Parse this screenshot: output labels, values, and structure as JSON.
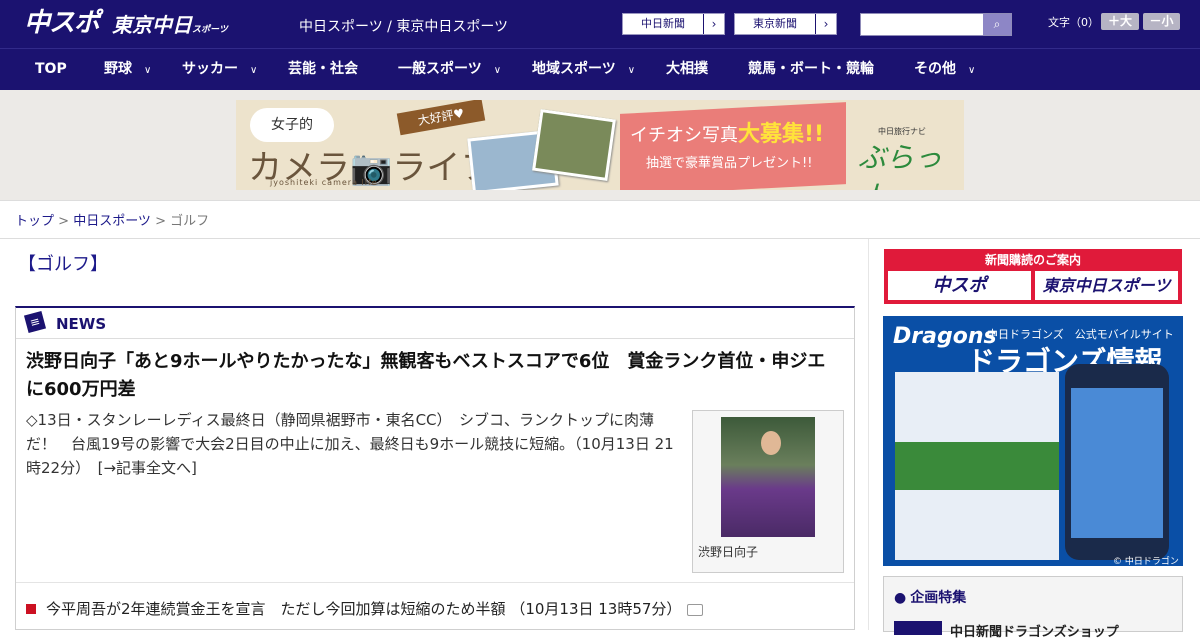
{
  "header": {
    "logo_chuspo": "中スポ",
    "logo_tokyo": "東京中日",
    "logo_tokyo_sub": "スポーツ",
    "site_links": "中日スポーツ / 東京中日スポーツ",
    "paper_buttons": [
      "中日新聞",
      "東京新聞"
    ],
    "search_placeholder": "",
    "fontsize_label": "文字（0）",
    "font_larger": "＋大",
    "font_smaller": "－小"
  },
  "nav": {
    "items": [
      "TOP",
      "野球",
      "サッカー",
      "芸能・社会",
      "一般スポーツ",
      "地域スポーツ",
      "大相撲",
      "競馬・ボート・競輪",
      "その他"
    ]
  },
  "banner": {
    "joshi": "女子的",
    "camera_life": "カメラ📷ライフ",
    "sub": "jyoshiteki camera life",
    "daikohyo": "大好評♥",
    "ichioshi": "イチオシ写真",
    "daiboshu": "大募集!!",
    "present": "抽選で豪華賞品プレゼント!!",
    "navi": "中日旅行ナビ",
    "burari": "ぶらっ人"
  },
  "breadcrumb": {
    "top": "トップ",
    "section": "中日スポーツ",
    "current": "ゴルフ"
  },
  "page_title": "【ゴルフ】",
  "news": {
    "label": "NEWS",
    "headline": "渋野日向子「あと9ホールやりたかったな」無観客もベストスコアで6位　賞金ランク首位・申ジエに600万円差",
    "body": "◇13日・スタンレーレディス最終日（静岡県裾野市・東名CC）　シブコ、ランクトップに肉薄だ！　台風19号の影響で大会2日目の中止に加え、最終日も9ホール競技に短縮。（10月13日 21時22分）　[→記事全文へ]",
    "photo_caption": "渋野日向子",
    "list": [
      "今平周吾が2年連続賞金王を宣言　ただし今回加算は短縮のため半額 （10月13日 13時57分）"
    ]
  },
  "sidebar": {
    "subscribe_title": "新聞購読のご案内",
    "subscribe_chuspo": "中スポ",
    "subscribe_tokyo": "東京中日スポーツ",
    "dragons_logo": "Dragons",
    "dragons_sub": "中日ドラゴンズ　公式モバイルサイト",
    "dragons_title": "ドラゴンズ情報",
    "dragons_copy": "© 中日ドラゴンズ",
    "kikaku_title": "企画特集",
    "kikaku_item": "中日新聞ドラゴンズショップ"
  },
  "colors": {
    "brand": "#1b1270",
    "accent_red": "#e01a3a"
  }
}
